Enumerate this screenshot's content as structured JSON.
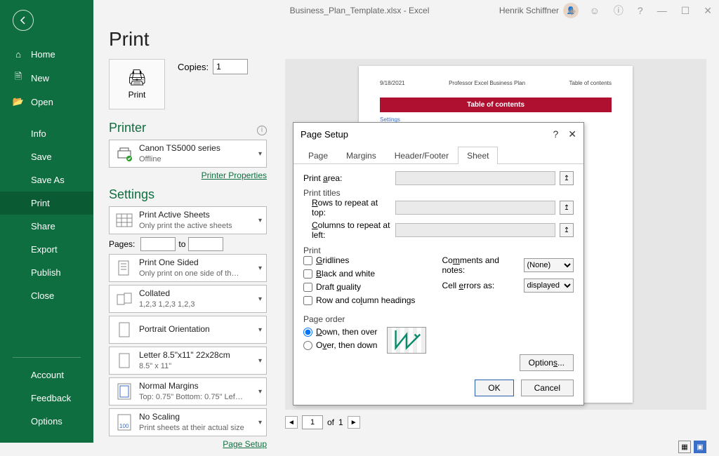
{
  "titlebar": {
    "filename": "Business_Plan_Template.xlsx  -  Excel",
    "user_name": "Henrik Schiffner"
  },
  "sidenav": {
    "home": "Home",
    "new": "New",
    "open": "Open",
    "info": "Info",
    "save": "Save",
    "save_as": "Save As",
    "print": "Print",
    "share": "Share",
    "export": "Export",
    "publish": "Publish",
    "close": "Close",
    "account": "Account",
    "feedback": "Feedback",
    "options": "Options"
  },
  "page": {
    "title": "Print",
    "print_btn": "Print",
    "copies_label": "Copies:",
    "copies_value": "1",
    "printer_section": "Printer",
    "printer_name": "Canon TS5000 series",
    "printer_status": "Offline",
    "printer_props": "Printer Properties",
    "settings_section": "Settings",
    "active_sheets_title": "Print Active Sheets",
    "active_sheets_sub": "Only print the active sheets",
    "pages_label": "Pages:",
    "pages_to": "to",
    "one_sided_title": "Print One Sided",
    "one_sided_sub": "Only print on one side of th…",
    "collated_title": "Collated",
    "collated_sub": "1,2,3    1,2,3    1,2,3",
    "orientation": "Portrait Orientation",
    "paper_title": "Letter 8.5\"x11\" 22x28cm",
    "paper_sub": "8.5\" x 11\"",
    "margins_title": "Normal Margins",
    "margins_sub": "Top: 0.75\" Bottom: 0.75\" Lef…",
    "scaling_title": "No Scaling",
    "scaling_sub": "Print sheets at their actual size",
    "page_setup_link": "Page Setup"
  },
  "preview": {
    "date": "9/18/2021",
    "header": "Professor Excel Business Plan",
    "corner": "Table of contents",
    "banner": "Table of contents",
    "link": "Settings",
    "current": "1",
    "of": "of",
    "total": "1"
  },
  "dialog": {
    "title": "Page Setup",
    "tab_page": "Page",
    "tab_margins": "Margins",
    "tab_header": "Header/Footer",
    "tab_sheet": "Sheet",
    "print_area": "Print area:",
    "print_titles": "Print titles",
    "rows_repeat": "Rows to repeat at top:",
    "cols_repeat": "Columns to repeat at left:",
    "print_section": "Print",
    "gridlines": "Gridlines",
    "bw": "Black and white",
    "draft": "Draft quality",
    "rowcol": "Row and column headings",
    "comments_label": "Comments and notes:",
    "comments_val": "(None)",
    "errors_label": "Cell errors as:",
    "errors_val": "displayed",
    "page_order": "Page order",
    "down_over": "Down, then over",
    "over_down": "Over, then down",
    "options": "Options...",
    "ok": "OK",
    "cancel": "Cancel"
  }
}
